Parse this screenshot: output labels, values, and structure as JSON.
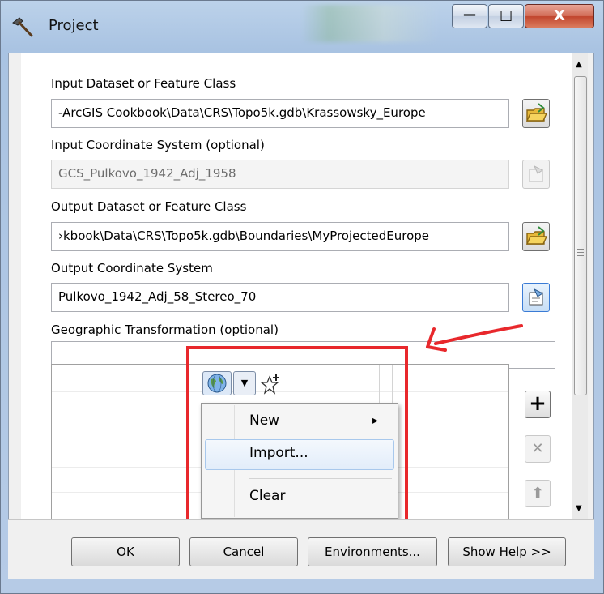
{
  "window": {
    "title": "Project",
    "caption_buttons": {
      "minimize": "—",
      "maximize": "□",
      "close": "X"
    }
  },
  "form": {
    "input_dataset": {
      "label": "Input Dataset or Feature Class",
      "value": "-ArcGIS Cookbook\\Data\\CRS\\Topo5k.gdb\\Krassowsky_Europe"
    },
    "input_crs": {
      "label": "Input Coordinate System (optional)",
      "value": "GCS_Pulkovo_1942_Adj_1958"
    },
    "output_dataset": {
      "label": "Output Dataset or Feature Class",
      "value": "›kbook\\Data\\CRS\\Topo5k.gdb\\Boundaries\\MyProjectedEurope"
    },
    "output_crs": {
      "label": "Output Coordinate System",
      "value": "Pulkovo_1942_Adj_58_Stereo_70"
    },
    "geo_transform": {
      "label": "Geographic Transformation (optional)",
      "value": ""
    }
  },
  "list_controls": {
    "add": "+",
    "remove": "✕",
    "move_up": "⬆"
  },
  "dropdown_menu": {
    "items": [
      {
        "label": "New",
        "submenu_arrow": "▸"
      },
      {
        "label": "Import..."
      },
      {
        "label": "Clear"
      }
    ]
  },
  "buttons": {
    "ok": "OK",
    "cancel": "Cancel",
    "environments": "Environments...",
    "show_help": "Show Help >>"
  },
  "colors": {
    "highlight_box": "#e8282c",
    "accent": "#3a7bd5"
  }
}
